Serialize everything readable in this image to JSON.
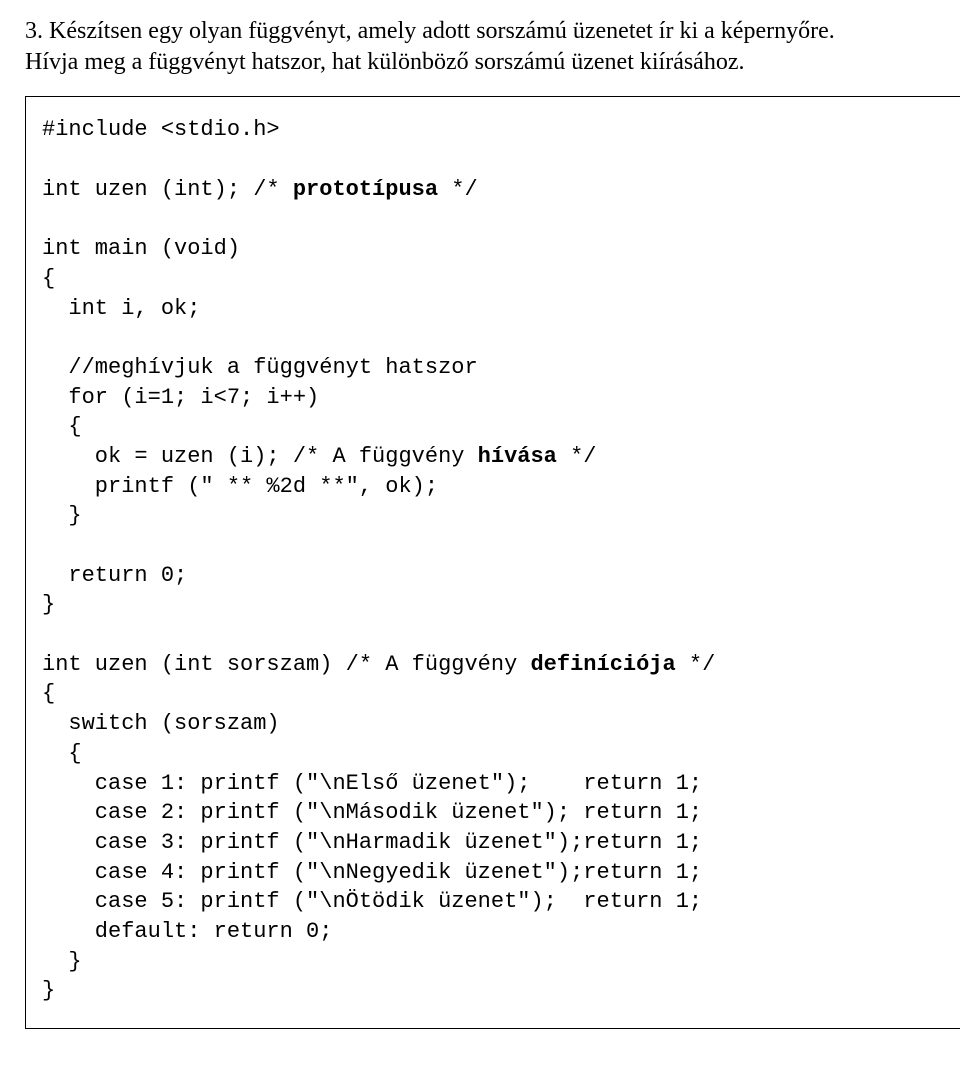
{
  "prompt": {
    "line1": "3. Készítsen egy olyan függvényt, amely adott sorszámú üzenetet ír ki a képernyőre.",
    "line2": "Hívja meg a függvényt hatszor, hat különböző sorszámú üzenet kiírásához."
  },
  "code": {
    "l1": "#include <stdio.h>",
    "l2": "int uzen (int); /* ",
    "l2b": "prototípusa",
    "l2c": " */",
    "l3": "int main (void)",
    "l4": "{",
    "l5": "  int i, ok;",
    "l6": "  //meghívjuk a függvényt hatszor",
    "l7": "  for (i=1; i<7; i++)",
    "l8": "  {",
    "l9": "    ok = uzen (i); /* A függvény ",
    "l9b": "hívása",
    "l9c": " */",
    "l10": "    printf (\" ** %2d **\", ok);",
    "l11": "  }",
    "l12": "  return 0;",
    "l13": "}",
    "l14": "int uzen (int sorszam) /* A függvény ",
    "l14b": "definíciója",
    "l14c": " */",
    "l15": "{",
    "l16": "  switch (sorszam)",
    "l17": "  {",
    "l18": "    case 1: printf (\"\\nElső üzenet\");    return 1;",
    "l19": "    case 2: printf (\"\\nMásodik üzenet\"); return 1;",
    "l20": "    case 3: printf (\"\\nHarmadik üzenet\");return 1;",
    "l21": "    case 4: printf (\"\\nNegyedik üzenet\");return 1;",
    "l22": "    case 5: printf (\"\\nÖtödik üzenet\");  return 1;",
    "l23": "    default: return 0;",
    "l24": "  }",
    "l25": "}"
  }
}
